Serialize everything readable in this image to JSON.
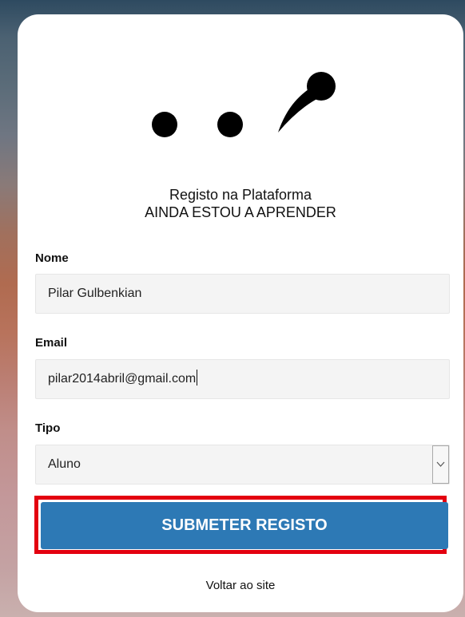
{
  "header": {
    "title_line1": "Registo na Plataforma",
    "title_line2": "AINDA ESTOU A APRENDER"
  },
  "form": {
    "name_label": "Nome",
    "name_value": "Pilar Gulbenkian",
    "email_label": "Email",
    "email_value": "pilar2014abril@gmail.com",
    "type_label": "Tipo",
    "type_value": "Aluno",
    "submit_label": "SUBMETER REGISTO"
  },
  "footer": {
    "back_link": "Voltar ao site"
  },
  "colors": {
    "primary_button": "#2d79b5",
    "highlight_border": "#e3000f"
  }
}
